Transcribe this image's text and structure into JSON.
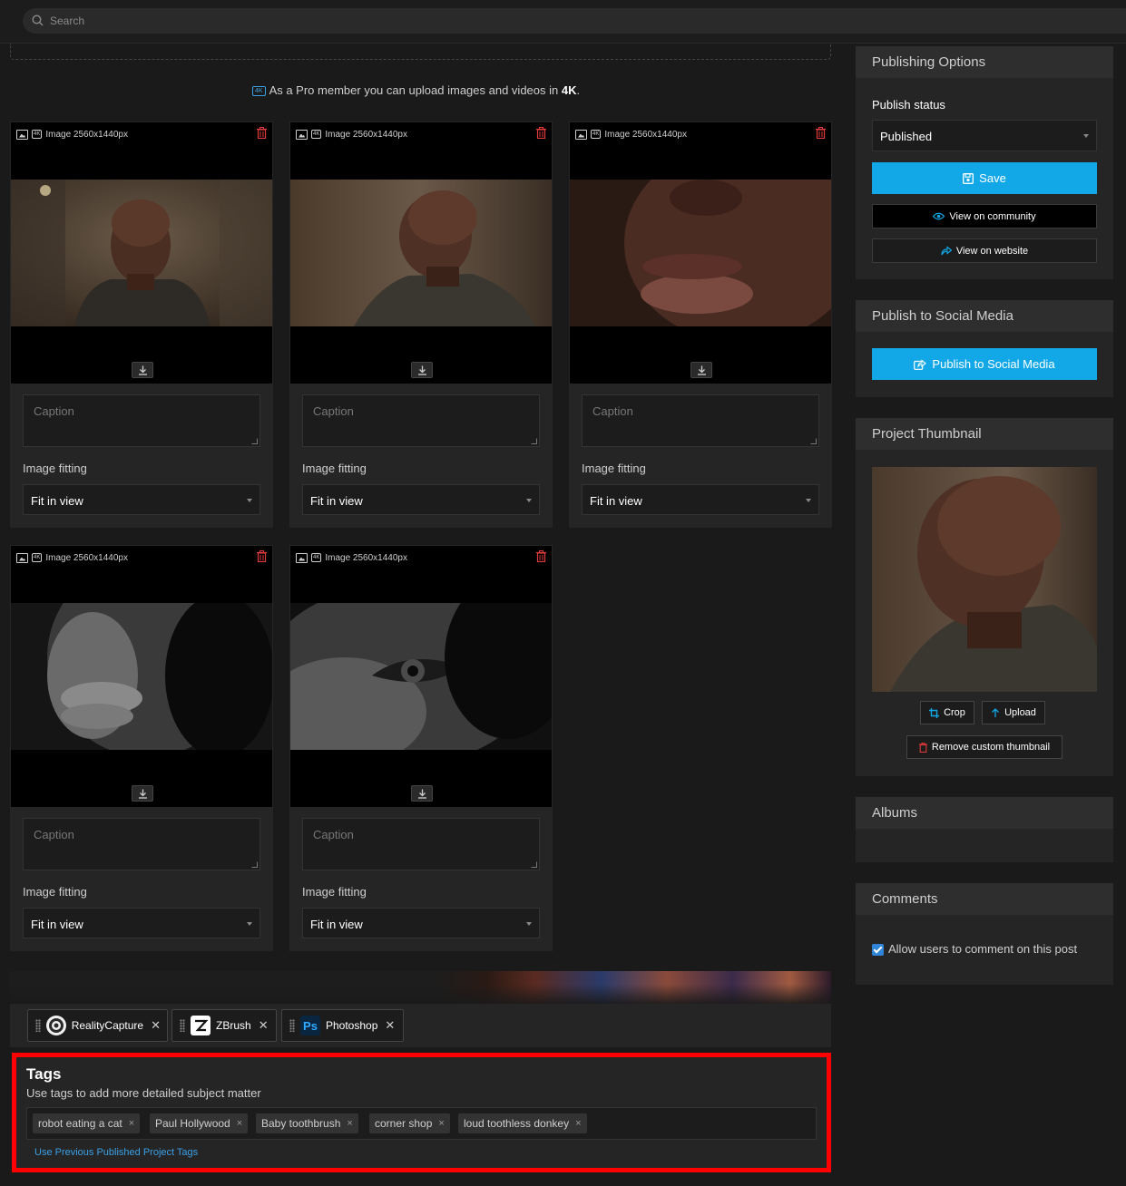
{
  "search": {
    "placeholder": "Search"
  },
  "pro_note": {
    "text": "As a Pro member you can upload images and videos in",
    "bold": "4K",
    "period": ".",
    "badge": "4K"
  },
  "media_cards": [
    {
      "type_label": "Image 2560x1440px",
      "caption_placeholder": "Caption",
      "fitting_label": "Image fitting",
      "fitting_value": "Fit in view"
    },
    {
      "type_label": "Image 2560x1440px",
      "caption_placeholder": "Caption",
      "fitting_label": "Image fitting",
      "fitting_value": "Fit in view"
    },
    {
      "type_label": "Image 2560x1440px",
      "caption_placeholder": "Caption",
      "fitting_label": "Image fitting",
      "fitting_value": "Fit in view"
    },
    {
      "type_label": "Image 2560x1440px",
      "caption_placeholder": "Caption",
      "fitting_label": "Image fitting",
      "fitting_value": "Fit in view"
    },
    {
      "type_label": "Image 2560x1440px",
      "caption_placeholder": "Caption",
      "fitting_label": "Image fitting",
      "fitting_value": "Fit in view"
    }
  ],
  "software": [
    {
      "name": "RealityCapture",
      "icon": "realitycapture-logo-icon"
    },
    {
      "name": "ZBrush",
      "icon": "zbrush-logo-icon"
    },
    {
      "name": "Photoshop",
      "icon": "photoshop-logo-icon",
      "logo_text": "Ps"
    }
  ],
  "tags": {
    "title": "Tags",
    "subtitle": "Use tags to add more detailed subject matter",
    "items": [
      "robot eating a cat",
      "Paul Hollywood",
      "Baby toothbrush",
      "corner shop",
      "loud toothless donkey"
    ],
    "remove_glyph": "×",
    "previous_link": "Use Previous Published Project Tags"
  },
  "publishing": {
    "title": "Publishing Options",
    "status_label": "Publish status",
    "status_value": "Published",
    "save_label": "Save",
    "view_community": "View on community",
    "view_website": "View on website"
  },
  "social": {
    "title": "Publish to Social Media",
    "button": "Publish to Social Media"
  },
  "thumbnail": {
    "title": "Project Thumbnail",
    "crop": "Crop",
    "upload": "Upload",
    "remove": "Remove custom thumbnail"
  },
  "albums": {
    "title": "Albums"
  },
  "comments": {
    "title": "Comments",
    "allow_label": "Allow users to comment on this post",
    "allow_checked": true
  },
  "colors": {
    "accent": "#12a8e8",
    "danger": "#e03a3a",
    "highlight": "#ff0000",
    "background": "#1a1a1a",
    "panel": "#252525"
  }
}
